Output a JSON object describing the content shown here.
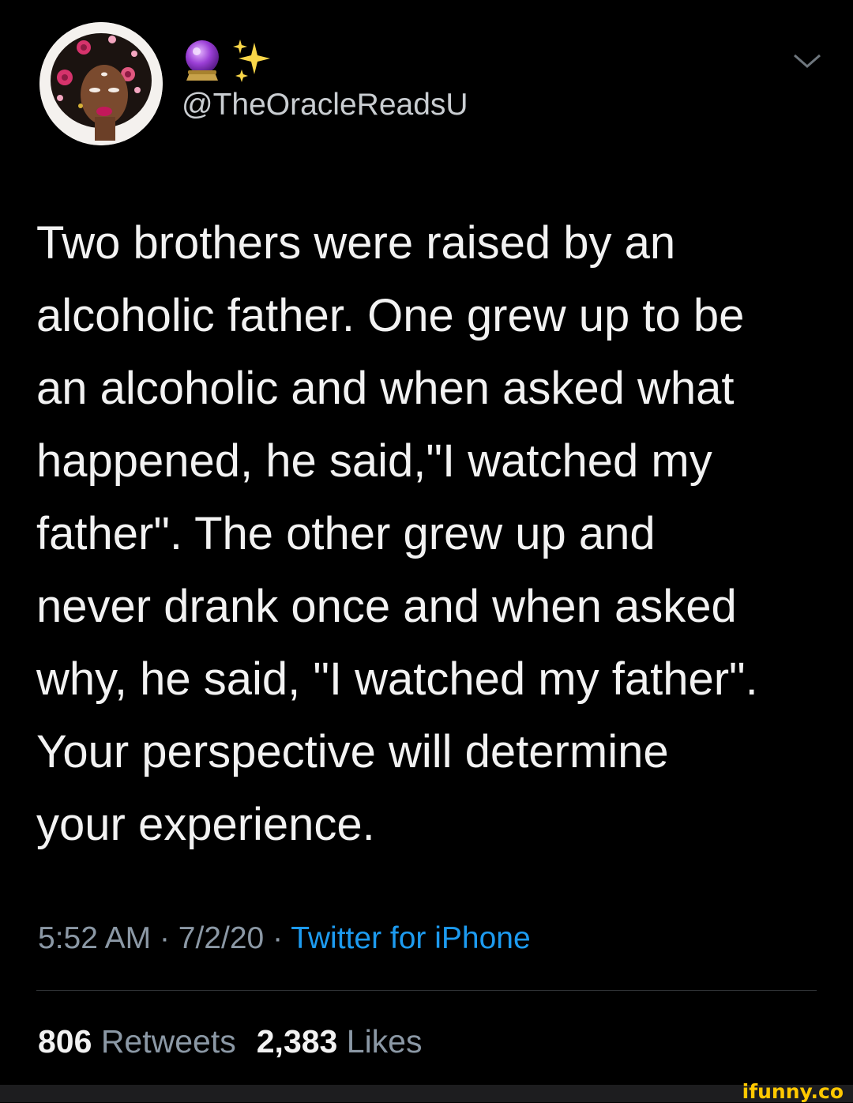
{
  "tweet": {
    "handle": "@TheOracleReadsU",
    "display_name_icons": [
      "crystal-ball-icon",
      "sparkles-icon"
    ],
    "text_lines": [
      "Two brothers were raised by an",
      "alcoholic father. One grew up to be",
      "an alcoholic and when asked what",
      "happened, he said,\"I watched my",
      "father\". The other grew up and",
      "never drank once and when asked",
      "why, he said, \"I watched my father\".",
      "Your perspective will determine",
      "your experience."
    ],
    "time": "5:52 AM",
    "date": "7/2/20",
    "separator": "·",
    "source": "Twitter for iPhone",
    "retweets_count": "806",
    "retweets_label": "Retweets",
    "likes_count": "2,383",
    "likes_label": "Likes"
  },
  "watermark": "ifunny.co",
  "colors": {
    "background": "#000000",
    "text": "#f2f2f2",
    "secondary": "#8b98a5",
    "accent": "#1d9bf0",
    "divider": "#2f3336",
    "watermark": "#ffc800"
  }
}
